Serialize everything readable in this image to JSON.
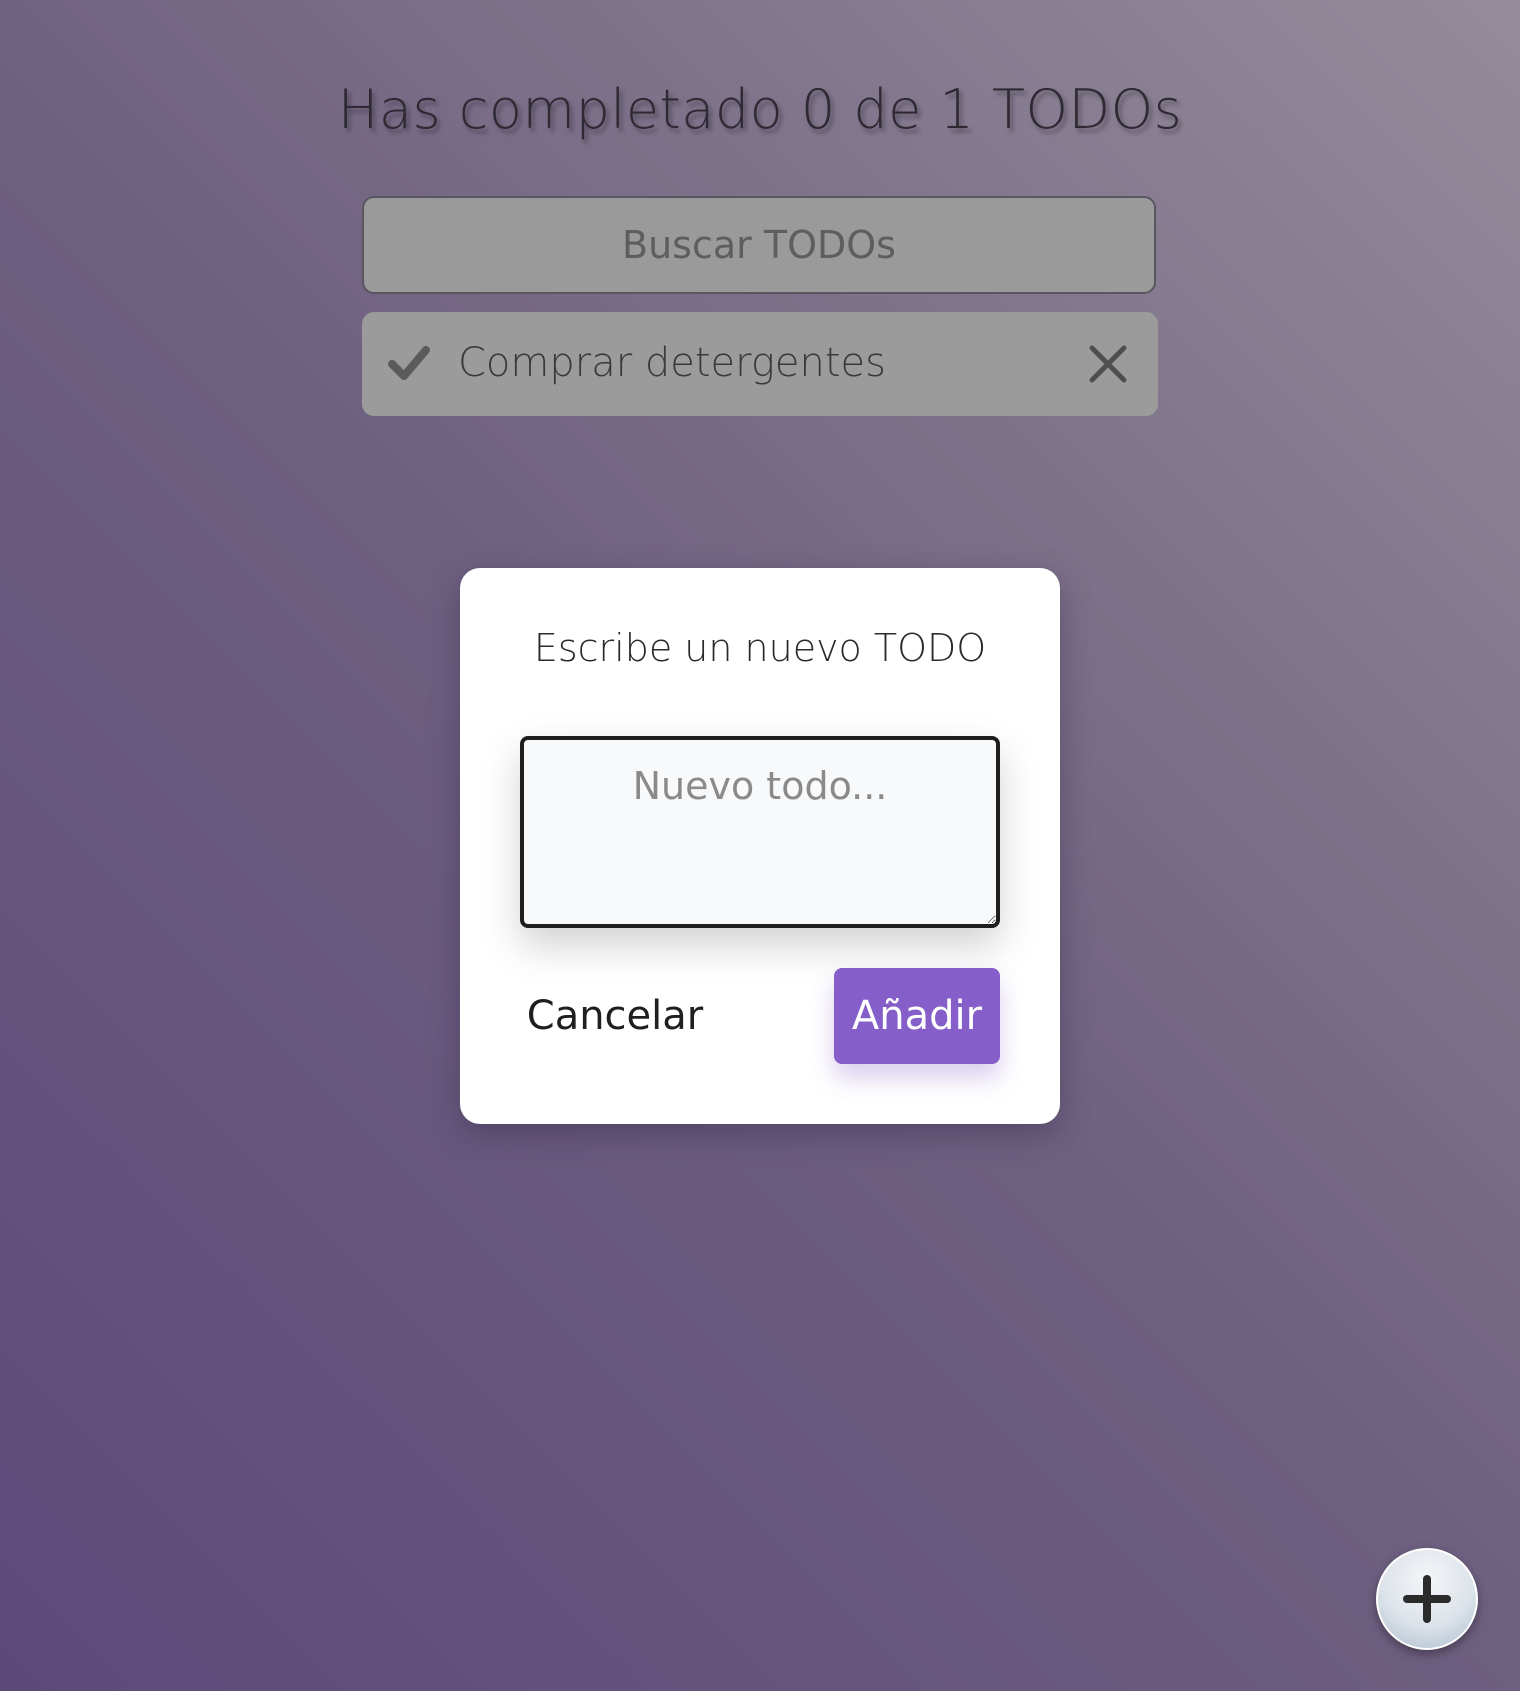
{
  "header": {
    "counter_text": "Has completado 0 de 1 TODOs"
  },
  "search": {
    "placeholder": "Buscar TODOs",
    "value": ""
  },
  "todos": [
    {
      "text": "Comprar detergentes",
      "completed": false,
      "check_icon": "check-icon",
      "delete_icon": "close-icon"
    }
  ],
  "modal": {
    "title": "Escribe un nuevo TODO",
    "textarea_placeholder": "Nuevo todo...",
    "textarea_value": "",
    "cancel_label": "Cancelar",
    "add_label": "Añadir"
  },
  "fab": {
    "icon": "plus-icon"
  },
  "colors": {
    "accent": "#855ec9",
    "background_start": "#5c4a79",
    "background_end": "#958c9a",
    "todo_item_bg": "#9b9b9b",
    "modal_bg": "#ffffff"
  }
}
